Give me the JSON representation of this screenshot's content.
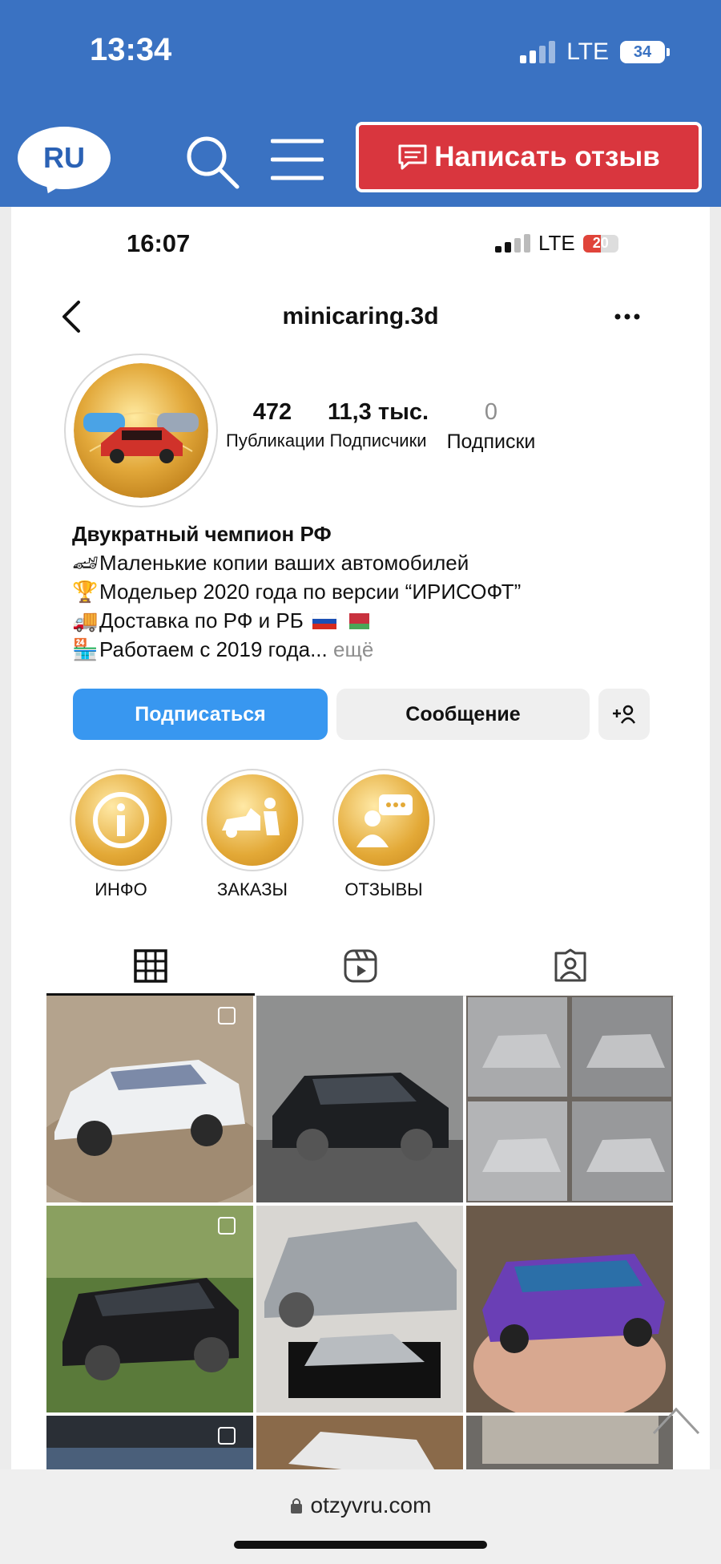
{
  "outer_status": {
    "time": "13:34",
    "network": "LTE",
    "battery": "34"
  },
  "site_header": {
    "logo": "RU",
    "review_button": "Написать отзыв"
  },
  "inner_status": {
    "time": "16:07",
    "network": "LTE",
    "battery": "20"
  },
  "profile": {
    "username": "minicaring.3d",
    "stats": [
      {
        "value": "472",
        "label": "Публикации"
      },
      {
        "value": "11,3 тыс.",
        "label": "Подписчики"
      },
      {
        "value": "0",
        "label": "Подписки"
      }
    ],
    "bio_name": "Двукратный чемпион РФ",
    "bio_lines": [
      "Маленькие копии ваших автомобилей",
      "Модельер 2020 года по версии “ИРИСОФТ”",
      "Доставка по РФ и РБ",
      "Работаем с 2019 года..."
    ],
    "bio_more": "ещё",
    "follow_button": "Подписаться",
    "message_button": "Сообщение"
  },
  "highlights": [
    {
      "label": "ИНФО",
      "icon": "info-icon"
    },
    {
      "label": "ЗАКАЗЫ",
      "icon": "car-repair-icon"
    },
    {
      "label": "ОТЗЫВЫ",
      "icon": "review-person-icon"
    }
  ],
  "tabs": [
    "grid-icon",
    "reels-icon",
    "tagged-icon"
  ],
  "posts": [
    {
      "desc": "white Lexus model on wood stump",
      "colors": [
        "#b4a38d",
        "#eef0f2"
      ]
    },
    {
      "desc": "black sedan model",
      "colors": [
        "#8f9090",
        "#1d1f22"
      ]
    },
    {
      "desc": "silver Skyline collage",
      "colors": [
        "#a9aaac",
        "#6c6660"
      ]
    },
    {
      "desc": "black Audi wagon model in grass",
      "colors": [
        "#5a7a3a",
        "#1c1c1e"
      ]
    },
    {
      "desc": "silver BMW coupe with model",
      "colors": [
        "#d8d6d2",
        "#9ea3a8"
      ]
    },
    {
      "desc": "purple chameleon Skyline in hand",
      "colors": [
        "#6b5a4a",
        "#6a3fb5"
      ]
    },
    {
      "desc": "car model",
      "colors": [
        "#4a5f7a",
        "#2a2f36"
      ]
    },
    {
      "desc": "white car model",
      "colors": [
        "#8a6a4a",
        "#e8e8e8"
      ]
    },
    {
      "desc": "car model",
      "colors": [
        "#6d6a66",
        "#b8b2a8"
      ]
    }
  ],
  "browser": {
    "url": "otzyvru.com"
  },
  "colors": {
    "header_blue": "#3a72c2",
    "review_red": "#d9363e",
    "follow_blue": "#3897f0"
  }
}
